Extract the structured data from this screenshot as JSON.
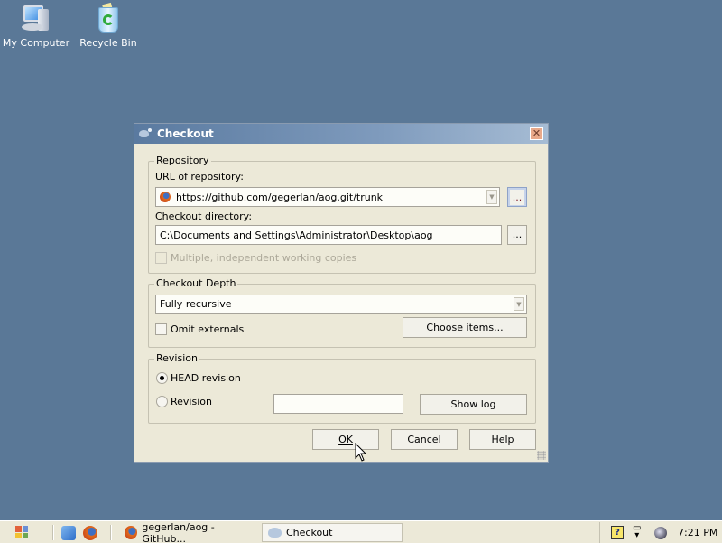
{
  "desktop": {
    "icons": [
      {
        "label": "My Computer",
        "icon": "my-computer-icon"
      },
      {
        "label": "Recycle Bin",
        "icon": "recycle-bin-icon"
      }
    ]
  },
  "dialog": {
    "title": "Checkout",
    "close_glyph": "✕",
    "repository": {
      "group_label": "Repository",
      "url_label": "URL of repository:",
      "url_value": "https://github.com/gegerlan/aog.git/trunk",
      "browse_label": "...",
      "dir_label": "Checkout directory:",
      "dir_value": "C:\\Documents and Settings\\Administrator\\Desktop\\aog",
      "dir_browse_label": "...",
      "multiple_label": "Multiple, independent working copies",
      "multiple_checked": false,
      "multiple_enabled": false
    },
    "depth": {
      "group_label": "Checkout Depth",
      "selected": "Fully recursive",
      "omit_externals_label": "Omit externals",
      "omit_externals_checked": false,
      "choose_items_label": "Choose items..."
    },
    "revision": {
      "group_label": "Revision",
      "head_label": "HEAD revision",
      "revision_label": "Revision",
      "selected": "HEAD revision",
      "revision_value": "",
      "show_log_label": "Show log"
    },
    "buttons": {
      "ok": "OK",
      "cancel": "Cancel",
      "help": "Help"
    }
  },
  "taskbar": {
    "tasks": [
      {
        "label": "gegerlan/aog - GitHub...",
        "icon": "firefox-icon",
        "active": false
      },
      {
        "label": "Checkout",
        "icon": "tortoisesvn-icon",
        "active": true
      }
    ],
    "tray": {
      "help_glyph": "?",
      "clock": "7:21 PM"
    }
  }
}
